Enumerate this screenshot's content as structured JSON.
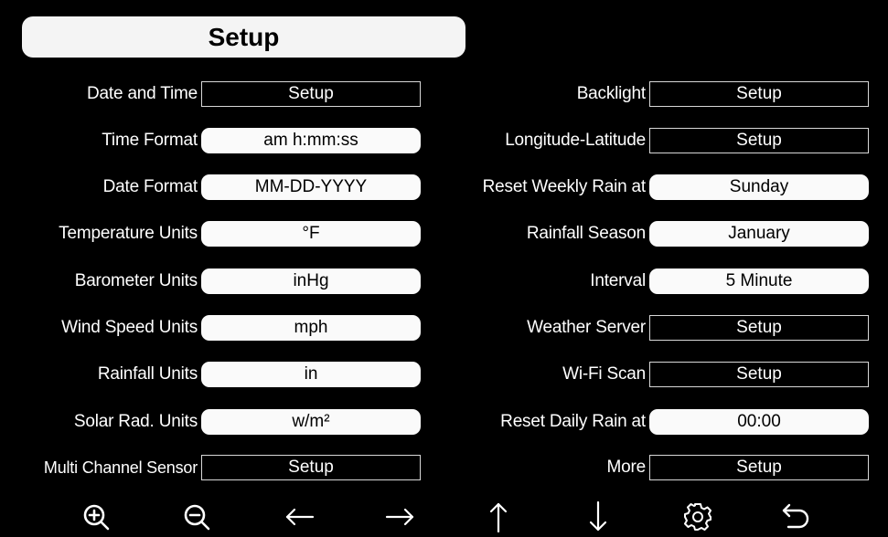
{
  "title": "Setup",
  "left_rows": [
    {
      "label": "Date and Time",
      "value": "Setup",
      "kind": "button"
    },
    {
      "label": "Time Format",
      "value": "am h:mm:ss",
      "kind": "select"
    },
    {
      "label": "Date Format",
      "value": "MM-DD-YYYY",
      "kind": "select"
    },
    {
      "label": "Temperature Units",
      "value": "°F",
      "kind": "select"
    },
    {
      "label": "Barometer Units",
      "value": "inHg",
      "kind": "select"
    },
    {
      "label": "Wind Speed Units",
      "value": "mph",
      "kind": "select"
    },
    {
      "label": "Rainfall Units",
      "value": "in",
      "kind": "select"
    },
    {
      "label": "Solar Rad. Units",
      "value": "w/m²",
      "kind": "select"
    },
    {
      "label": "Multi Channel Sensor",
      "value": "Setup",
      "kind": "button"
    }
  ],
  "right_rows": [
    {
      "label": "Backlight",
      "value": "Setup",
      "kind": "button"
    },
    {
      "label": "Longitude-Latitude",
      "value": "Setup",
      "kind": "button"
    },
    {
      "label": "Reset Weekly Rain at",
      "value": "Sunday",
      "kind": "select"
    },
    {
      "label": "Rainfall Season",
      "value": "January",
      "kind": "select"
    },
    {
      "label": "Interval",
      "value": "5 Minute",
      "kind": "select"
    },
    {
      "label": "Weather Server",
      "value": "Setup",
      "kind": "button"
    },
    {
      "label": "Wi-Fi Scan",
      "value": "Setup",
      "kind": "button"
    },
    {
      "label": "Reset Daily Rain at",
      "value": "00:00",
      "kind": "select"
    },
    {
      "label": "More",
      "value": "Setup",
      "kind": "button"
    }
  ],
  "toolbar": {
    "icons": [
      "zoom-in-icon",
      "zoom-out-icon",
      "arrow-left-icon",
      "arrow-right-icon",
      "arrow-up-icon",
      "arrow-down-icon",
      "gear-icon",
      "back-icon"
    ]
  },
  "colors": {
    "background": "#000000",
    "text": "#ffffff",
    "field_fill": "#fafafa",
    "field_border": "#d8d8d8"
  }
}
